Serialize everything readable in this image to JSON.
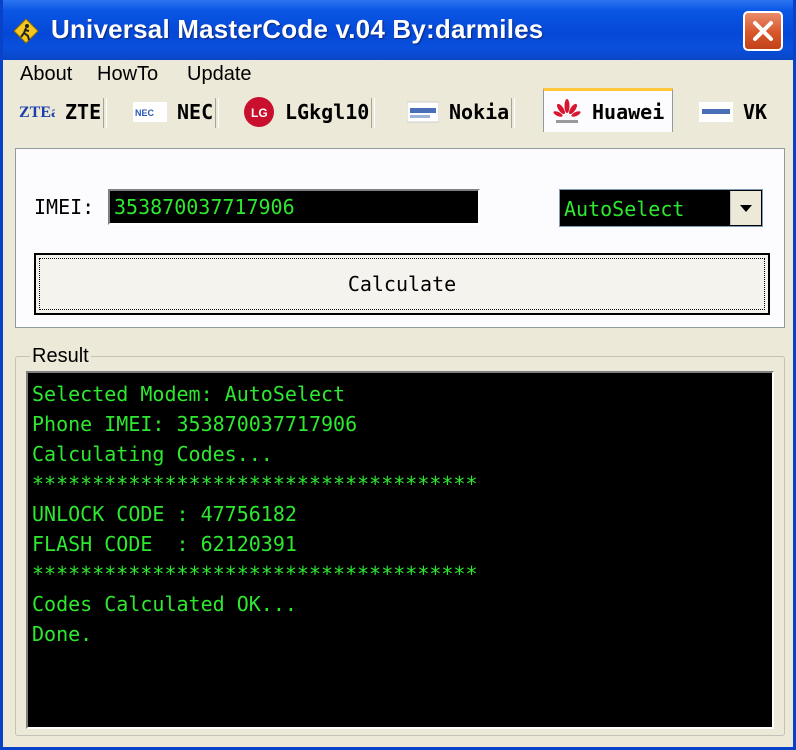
{
  "window": {
    "title": "Universal MasterCode v.04 By:darmiles"
  },
  "menu": {
    "items": [
      "About",
      "HowTo",
      "Update"
    ]
  },
  "tabs": [
    {
      "label": "ZTE",
      "logo_text": "ZTEa"
    },
    {
      "label": "NEC",
      "logo_text": "NEC"
    },
    {
      "label": "LGkgl10",
      "logo_text": "LG"
    },
    {
      "label": "Nokia"
    },
    {
      "label": "Huawei",
      "active": true
    },
    {
      "label": "VK"
    }
  ],
  "form": {
    "imei_label": "IMEI:",
    "imei_value": "353870037717906",
    "modem_select": "AutoSelect",
    "calculate_label": "Calculate"
  },
  "result": {
    "label": "Result",
    "lines": [
      "Selected Modem: AutoSelect",
      "Phone IMEI: 353870037717906",
      "Calculating Codes...",
      "*************************************",
      "UNLOCK CODE : 47756182",
      "FLASH CODE  : 62120391",
      "*************************************",
      "Codes Calculated OK...",
      "Done."
    ]
  },
  "colors": {
    "titlebar": "#0548d8",
    "terminal_text": "#2ee830",
    "terminal_bg": "#000000",
    "close_button": "#d8572a"
  }
}
